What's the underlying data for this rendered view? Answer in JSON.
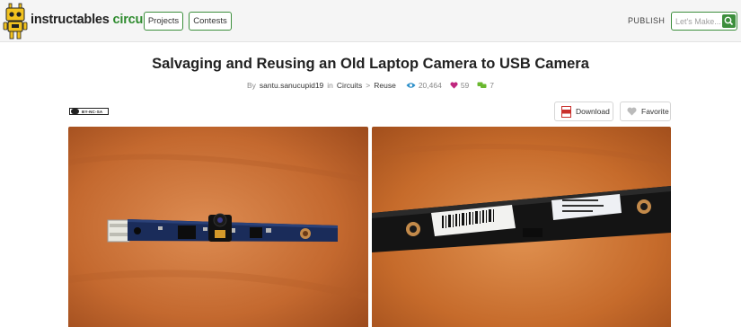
{
  "header": {
    "brand_main": "instructables",
    "brand_channel": "circuits",
    "nav": [
      {
        "label": "Projects"
      },
      {
        "label": "Contests"
      }
    ],
    "publish_label": "PUBLISH",
    "search_placeholder": "Let's Make..."
  },
  "article": {
    "title": "Salvaging and Reusing an Old Laptop Camera to USB Camera",
    "by_label": "By",
    "author": "santu.sanucupid19",
    "in_label": "in",
    "category": "Circuits",
    "breadcrumb_separator": ">",
    "subcategory": "Reuse",
    "views": "20,464",
    "favorites": "59",
    "comments": "7"
  },
  "license_text": "BY-NC-SA",
  "actions": {
    "download_label": "Download",
    "favorite_label": "Favorite"
  },
  "colors": {
    "brand_green": "#2e8b2e",
    "views_icon": "#2c8fc9",
    "favorites_icon": "#c0267e",
    "comments_icon": "#6ab82f"
  },
  "images": [
    {
      "name": "camera-module-front"
    },
    {
      "name": "camera-module-back"
    }
  ]
}
